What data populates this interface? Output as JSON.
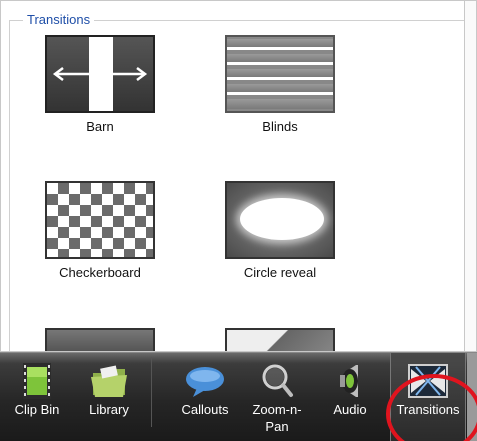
{
  "panel": {
    "group_title": "Transitions",
    "transitions": [
      {
        "label": "Barn"
      },
      {
        "label": "Blinds"
      },
      {
        "label": "Checkerboard"
      },
      {
        "label": "Circle reveal"
      }
    ]
  },
  "toolbar": {
    "buttons": [
      {
        "label": "Clip Bin",
        "icon": "film-strip-icon"
      },
      {
        "label": "Library",
        "icon": "folder-icon"
      },
      {
        "label": "Callouts",
        "icon": "speech-bubble-icon"
      },
      {
        "label": "Zoom-n-Pan",
        "icon": "magnifier-icon"
      },
      {
        "label": "Audio",
        "icon": "speaker-icon"
      },
      {
        "label": "Transitions",
        "icon": "transition-icon"
      }
    ],
    "active": "Transitions"
  },
  "colors": {
    "group_title": "#1f4fa8",
    "highlight_ring": "#e0141e",
    "toolbar_bg": "#262626",
    "toolbar_text": "#ffffff"
  }
}
